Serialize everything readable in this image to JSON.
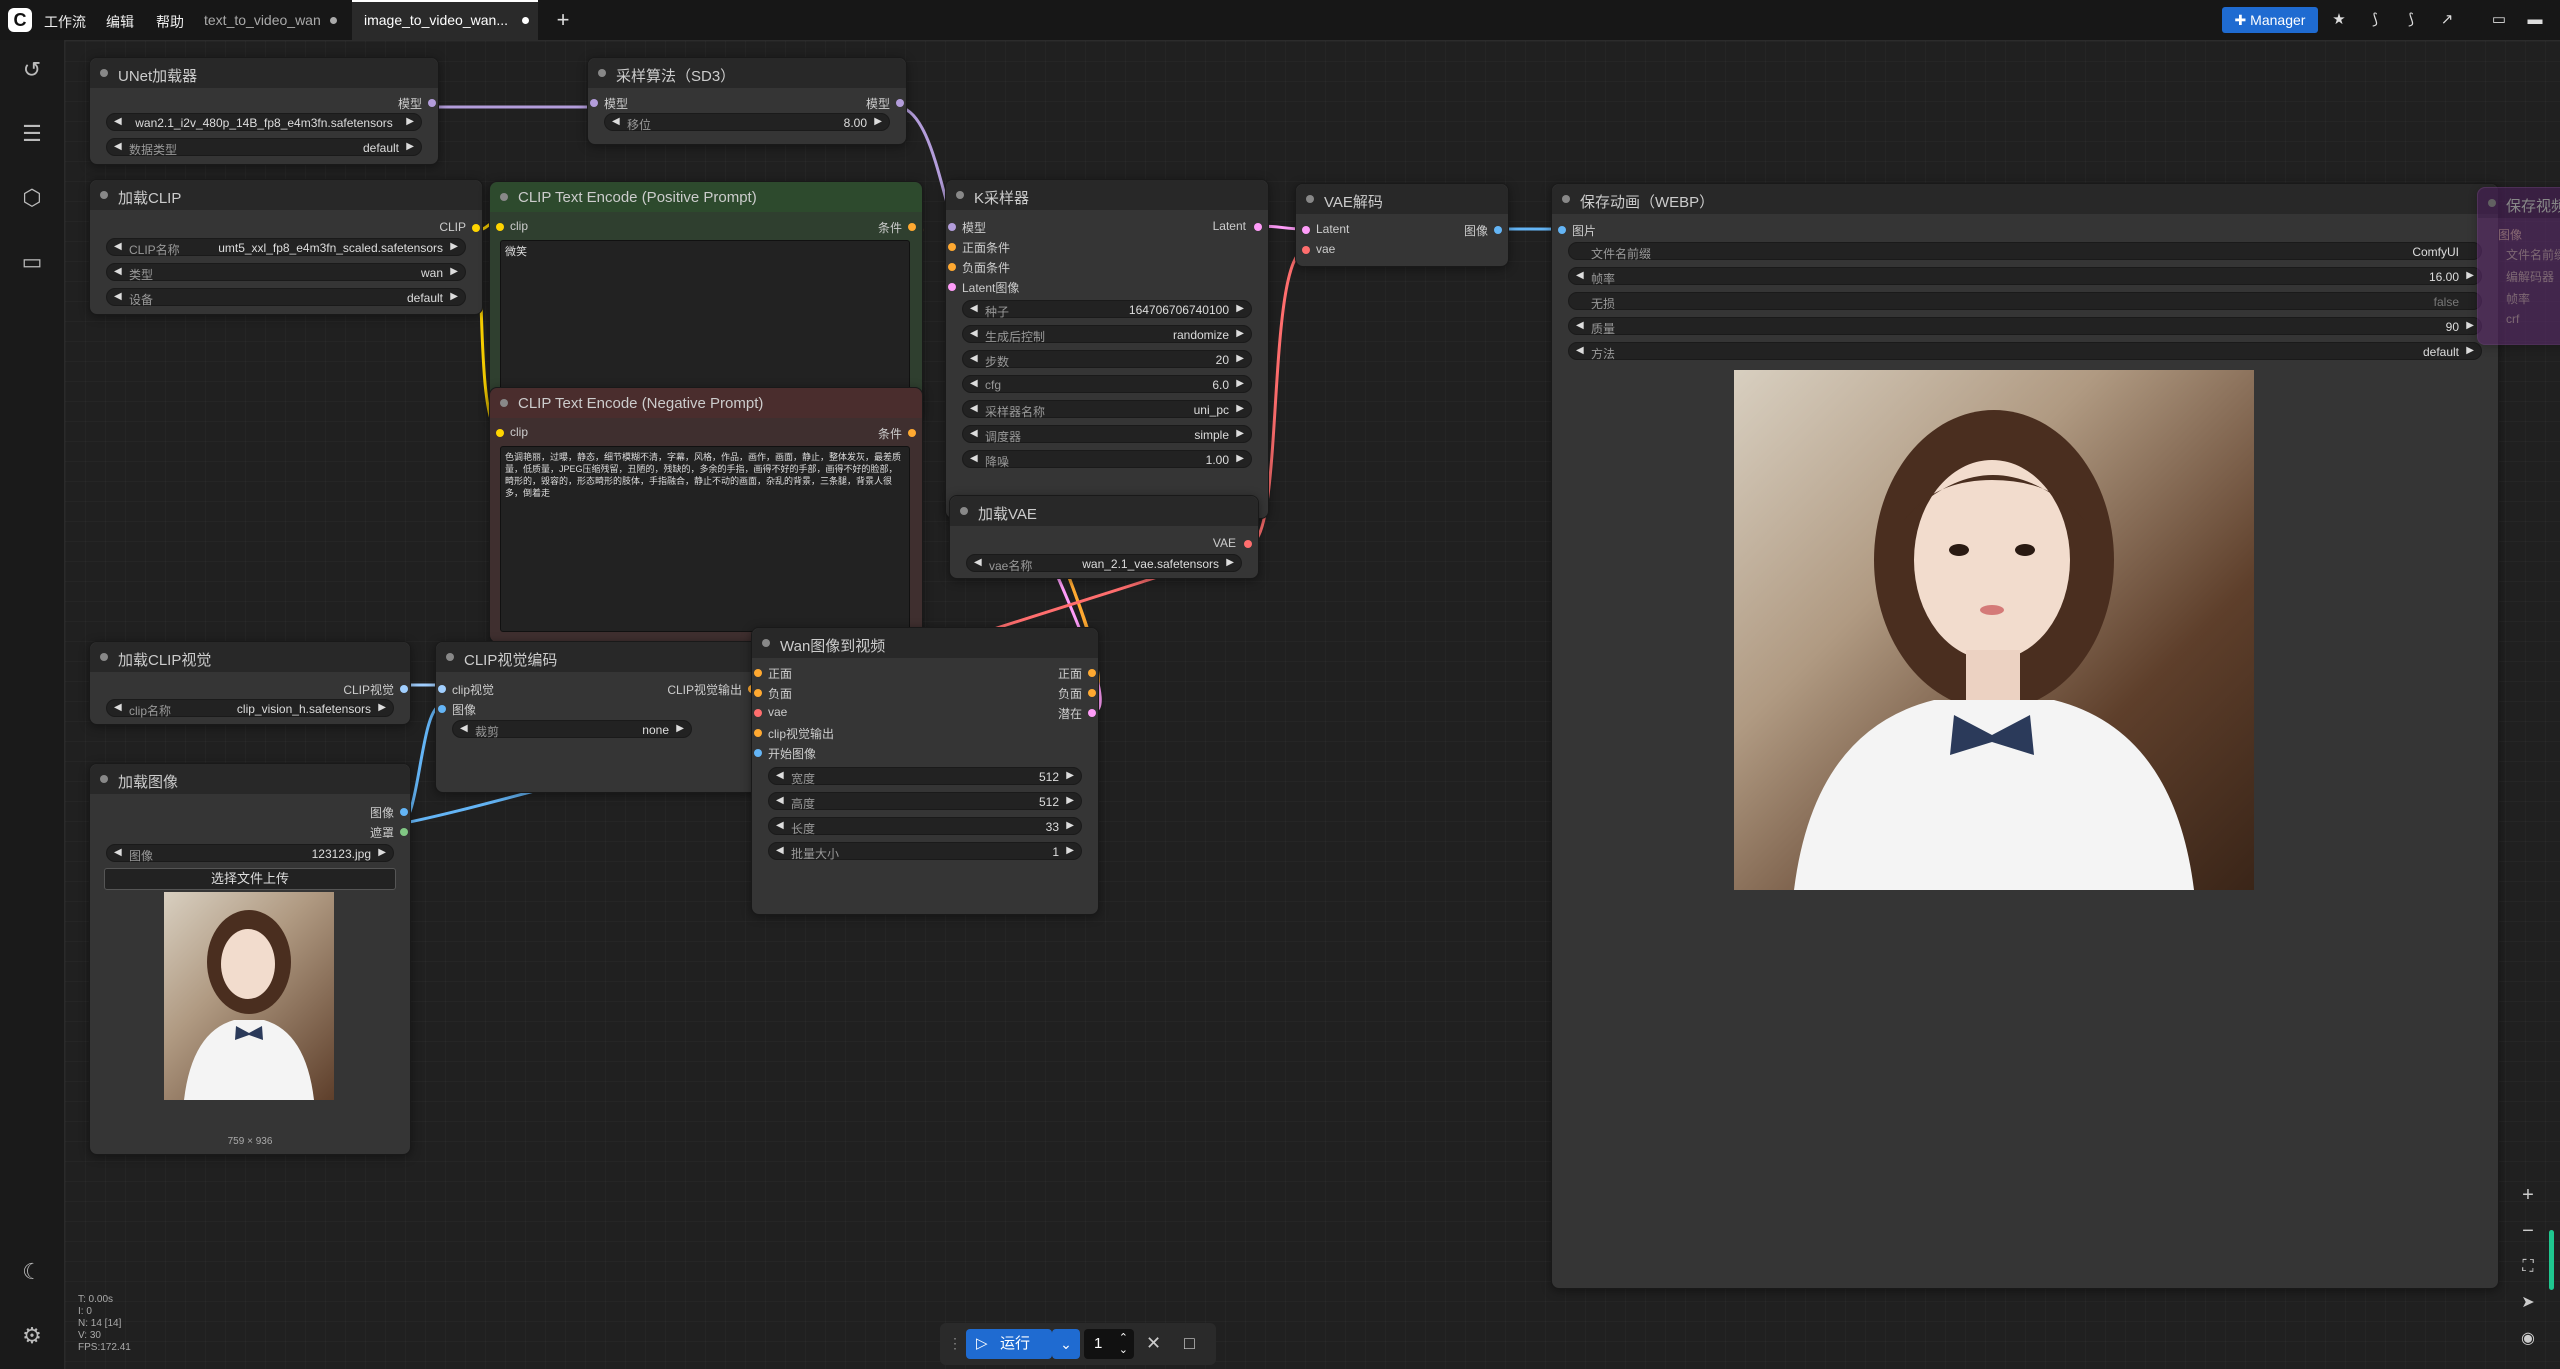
{
  "menu": {
    "workflow": "工作流",
    "edit": "编辑",
    "help": "帮助"
  },
  "tabs": [
    {
      "label": "text_to_video_wan"
    },
    {
      "label": "image_to_video_wan..."
    }
  ],
  "toolbar": {
    "manager_label": "Manager"
  },
  "nodes": {
    "unet": {
      "title": "UNet加载器",
      "out_model": "模型",
      "w_model_value": "wan2.1_i2v_480p_14B_fp8_e4m3fn.safetensors",
      "w_dtype_label": "数据类型",
      "w_dtype_value": "default"
    },
    "sampling": {
      "title": "采样算法（SD3）",
      "in_model": "模型",
      "out_model": "模型",
      "w_shift_label": "移位",
      "w_shift_value": "8.00"
    },
    "clip_loader": {
      "title": "加载CLIP",
      "out_clip": "CLIP",
      "w_name_label": "CLIP名称",
      "w_name_value": "umt5_xxl_fp8_e4m3fn_scaled.safetensors",
      "w_type_label": "类型",
      "w_type_value": "wan",
      "w_device_label": "设备",
      "w_device_value": "default"
    },
    "pos_prompt": {
      "title": "CLIP Text Encode (Positive Prompt)",
      "in_clip": "clip",
      "out_cond": "条件",
      "text": "微笑"
    },
    "neg_prompt": {
      "title": "CLIP Text Encode (Negative Prompt)",
      "in_clip": "clip",
      "out_cond": "条件",
      "text": "色调艳丽，过曝，静态，细节模糊不清，字幕，风格，作品，画作，画面，静止，整体发灰，最差质量，低质量，JPEG压缩残留，丑陋的，残缺的，多余的手指，画得不好的手部，画得不好的脸部，畸形的，毁容的，形态畸形的肢体，手指融合，静止不动的画面，杂乱的背景，三条腿，背景人很多，倒着走"
    },
    "ksampler": {
      "title": "K采样器",
      "in_model": "模型",
      "in_pos": "正面条件",
      "in_neg": "负面条件",
      "in_latent": "Latent图像",
      "out_latent": "Latent",
      "widgets": [
        {
          "label": "种子",
          "value": "164706706740100"
        },
        {
          "label": "生成后控制",
          "value": "randomize"
        },
        {
          "label": "步数",
          "value": "20"
        },
        {
          "label": "cfg",
          "value": "6.0"
        },
        {
          "label": "采样器名称",
          "value": "uni_pc"
        },
        {
          "label": "调度器",
          "value": "simple"
        },
        {
          "label": "降噪",
          "value": "1.00"
        }
      ]
    },
    "vae_decode": {
      "title": "VAE解码",
      "in_latent": "Latent",
      "in_vae": "vae",
      "out_image": "图像"
    },
    "save_webp": {
      "title": "保存动画（WEBP）",
      "in_images": "图片",
      "widgets": [
        {
          "label": "文件名前缀",
          "value": "ComfyUI"
        },
        {
          "label": "帧率",
          "value": "16.00"
        },
        {
          "label": "无损",
          "value": "false"
        },
        {
          "label": "质量",
          "value": "90"
        },
        {
          "label": "方法",
          "value": "default"
        }
      ]
    },
    "save_ghost": {
      "title": "保存视频",
      "in_images": "图像",
      "w1": "文件名前缀",
      "w2": "编解码器",
      "w3": "帧率",
      "w4": "crf"
    },
    "vae_loader": {
      "title": "加载VAE",
      "out_vae": "VAE",
      "w_name_label": "vae名称",
      "w_name_value": "wan_2.1_vae.safetensors"
    },
    "clip_vision_loader": {
      "title": "加载CLIP视觉",
      "out": "CLIP视觉",
      "w_name_label": "clip名称",
      "w_name_value": "clip_vision_h.safetensors"
    },
    "clip_vision_encode": {
      "title": "CLIP视觉编码",
      "in_clipvision": "clip视觉",
      "in_image": "图像",
      "out": "CLIP视觉输出",
      "w_crop_label": "裁剪",
      "w_crop_value": "none"
    },
    "wan_i2v": {
      "title": "Wan图像到视频",
      "in_pos": "正面",
      "in_neg": "负面",
      "in_vae": "vae",
      "in_clip_out": "clip视觉输出",
      "in_start": "开始图像",
      "out_pos": "正面",
      "out_neg": "负面",
      "out_latent": "潜在",
      "widgets": [
        {
          "label": "宽度",
          "value": "512"
        },
        {
          "label": "高度",
          "value": "512"
        },
        {
          "label": "长度",
          "value": "33"
        },
        {
          "label": "批量大小",
          "value": "1"
        }
      ]
    },
    "load_image": {
      "title": "加载图像",
      "out_image": "图像",
      "out_mask": "遮罩",
      "w_image_label": "图像",
      "w_image_value": "123123.jpg",
      "upload_label": "选择文件上传",
      "dims": "759 × 936"
    }
  },
  "stats": {
    "t": "T: 0.00s",
    "i": "I: 0",
    "n": "N: 14 [14]",
    "v": "V: 30",
    "fps": "FPS:172.41"
  },
  "run": {
    "label": "运行",
    "count": "1"
  },
  "colors": {
    "model": "#b39ddb",
    "clip": "#ffd500",
    "cond": "#ffa931",
    "latent": "#ff9cf9",
    "vae": "#ff6e6e",
    "image": "#64b5f6",
    "clip_vision": "#a1cfff",
    "positive_node": "#2d4a2d",
    "negative_node": "#4a2d2d"
  }
}
